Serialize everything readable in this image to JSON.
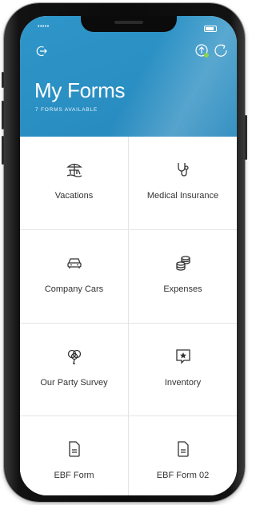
{
  "header": {
    "title": "My Forms",
    "subtitle": "7 FORMS AVAILABLE",
    "status_signal": "•••••",
    "accent_color": "#2a8fc3"
  },
  "icons": {
    "logout": "logout-icon",
    "upload": "upload-icon",
    "refresh": "refresh-icon"
  },
  "forms": [
    {
      "label": "Vacations",
      "icon": "beach-chair-icon"
    },
    {
      "label": "Medical Insurance",
      "icon": "stethoscope-icon"
    },
    {
      "label": "Company Cars",
      "icon": "car-icon"
    },
    {
      "label": "Expenses",
      "icon": "coins-icon"
    },
    {
      "label": "Our Party Survey",
      "icon": "balloons-icon"
    },
    {
      "label": "Inventory",
      "icon": "star-message-icon"
    },
    {
      "label": "EBF Form",
      "icon": "document-icon"
    },
    {
      "label": "EBF Form 02",
      "icon": "document-icon"
    }
  ]
}
